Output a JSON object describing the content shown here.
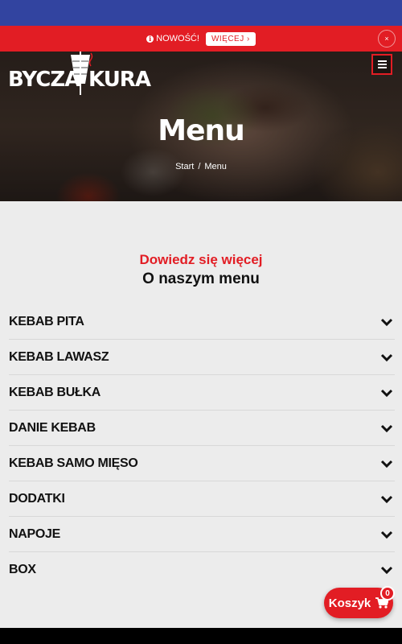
{
  "promo": {
    "text": "NOWOŚĆ!",
    "more_label": "WIĘCEJ ›",
    "close_label": "×"
  },
  "header": {
    "logo_part1": "BYCZA",
    "logo_part2": "KURA"
  },
  "hero": {
    "title": "Menu",
    "breadcrumb": [
      "Start",
      "Menu"
    ]
  },
  "section": {
    "subtitle": "Dowiedz się więcej",
    "title": "O naszym menu"
  },
  "menu_categories": [
    "KEBAB PITA",
    "KEBAB LAWASZ",
    "KEBAB BUŁKA",
    "DANIE KEBAB",
    "KEBAB SAMO MIĘSO",
    "DODATKI",
    "NAPOJE",
    "BOX"
  ],
  "cart": {
    "label": "Koszyk",
    "count": "0"
  },
  "colors": {
    "accent": "#e21d24",
    "status_bar": "#3244a0"
  }
}
